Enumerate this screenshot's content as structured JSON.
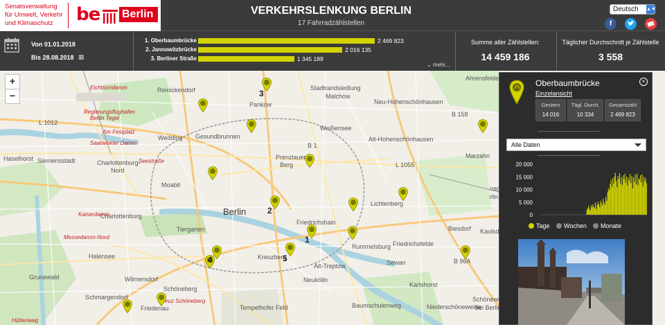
{
  "header": {
    "logo_text": [
      "Senatsverwaltung",
      "für Umwelt, Verkehr",
      "und Klimaschutz"
    ],
    "logo_be": "be",
    "logo_berlin": "Berlin",
    "title": "VERKEHRSLENKUNG BERLIN",
    "subtitle": "17 Fahrradzählstellen",
    "language": "Deutsch",
    "social": [
      "facebook-icon",
      "twitter-icon",
      "mail-icon"
    ]
  },
  "stats": {
    "date_from": "Von 01.01.2018",
    "date_to": "Bis 28.08.2018",
    "ranking": [
      {
        "label": "1. Oberbaumbrücke",
        "value_text": "2 469 823",
        "value": 2469823
      },
      {
        "label": "2. Jannowitzbrücke",
        "value_text": "2 016 135",
        "value": 2016135
      },
      {
        "label": "3. Berliner Straße",
        "value_text": "1 345 189",
        "value": 1345189
      }
    ],
    "more": "mehr...",
    "sum_label": "Summe aller Zählstellen:",
    "sum_value": "14 459 186",
    "avg_label": "Täglicher Durchschnitt je Zählstelle",
    "avg_value": "3 558"
  },
  "map": {
    "zoom_in": "+",
    "zoom_out": "−",
    "labels": [
      {
        "text": "Reinickendorf",
        "cls": ""
      },
      {
        "text": "Pankow",
        "cls": ""
      },
      {
        "text": "Stadtrandsiedlung",
        "cls": ""
      },
      {
        "text": "Malchow",
        "cls": ""
      },
      {
        "text": "Ahrensfelde",
        "cls": ""
      },
      {
        "text": "Neu-Hohenschönhausen",
        "cls": ""
      },
      {
        "text": "Weißensee",
        "cls": ""
      },
      {
        "text": "Alt-Hohenschönhausen",
        "cls": ""
      },
      {
        "text": "Gesundbrunnen",
        "cls": ""
      },
      {
        "text": "Prenzlauer",
        "cls": ""
      },
      {
        "text": "Berg",
        "cls": ""
      },
      {
        "text": "Wedding",
        "cls": ""
      },
      {
        "text": "Haselhorst",
        "cls": ""
      },
      {
        "text": "Siemensstadt",
        "cls": ""
      },
      {
        "text": "Charlottenburg-",
        "cls": ""
      },
      {
        "text": "Nord",
        "cls": ""
      },
      {
        "text": "Moabit",
        "cls": ""
      },
      {
        "text": "Berlin",
        "cls": "big"
      },
      {
        "text": "Lichtenberg",
        "cls": ""
      },
      {
        "text": "Charlottenburg",
        "cls": ""
      },
      {
        "text": "Tiergarten",
        "cls": ""
      },
      {
        "text": "Friedrichshain",
        "cls": ""
      },
      {
        "text": "Biesdorf",
        "cls": ""
      },
      {
        "text": "Kaulsdo",
        "cls": ""
      },
      {
        "text": "Rummelsburg",
        "cls": ""
      },
      {
        "text": "Friedrichsfelde",
        "cls": ""
      },
      {
        "text": "Halensee",
        "cls": ""
      },
      {
        "text": "Kreuzberg",
        "cls": ""
      },
      {
        "text": "Alt-Treptow",
        "cls": ""
      },
      {
        "text": "Grunewald",
        "cls": ""
      },
      {
        "text": "Wilmersdorf",
        "cls": ""
      },
      {
        "text": "Schöneberg",
        "cls": ""
      },
      {
        "text": "Neukölln",
        "cls": ""
      },
      {
        "text": "Karlshorst",
        "cls": ""
      },
      {
        "text": "Schmargendorf",
        "cls": ""
      },
      {
        "text": "Niederschöneweide",
        "cls": ""
      },
      {
        "text": "Friedenau",
        "cls": ""
      },
      {
        "text": "Baumschulenweg",
        "cls": ""
      },
      {
        "text": "Eichborndamm",
        "cls": "red"
      },
      {
        "text": "Regierungsflughafen",
        "cls": "red"
      },
      {
        "text": "Berlin Tegel",
        "cls": "red"
      },
      {
        "text": "Am Festplatz",
        "cls": "red"
      },
      {
        "text": "Saatwinkler Damm",
        "cls": "red"
      },
      {
        "text": "Seestraße",
        "cls": "red"
      },
      {
        "text": "Kaiserdamm",
        "cls": "red"
      },
      {
        "text": "Messedamm-Nord",
        "cls": "red"
      },
      {
        "text": "Kreuz Schöneberg",
        "cls": "red"
      },
      {
        "text": "Tempelhofer Feld",
        "cls": ""
      },
      {
        "text": "Hüttenweg",
        "cls": "red"
      },
      {
        "text": "Sewan",
        "cls": ""
      },
      {
        "text": "Schönewe",
        "cls": ""
      },
      {
        "text": "bei Berlin",
        "cls": ""
      },
      {
        "text": "nagen",
        "cls": ""
      },
      {
        "text": "rlin",
        "cls": ""
      },
      {
        "text": "Marzahn",
        "cls": ""
      },
      {
        "text": "L 1012",
        "cls": ""
      },
      {
        "text": "L 1055",
        "cls": ""
      },
      {
        "text": "B 158",
        "cls": ""
      },
      {
        "text": "B 1",
        "cls": ""
      },
      {
        "text": "B 96A",
        "cls": ""
      }
    ],
    "marker_ranks": [
      "3",
      "2",
      "1",
      "5",
      "4"
    ]
  },
  "panel": {
    "title": "Oberbaumbrücke",
    "subtitle": "Einzelansicht",
    "stats": [
      {
        "label": "Gestern",
        "value": "14 016"
      },
      {
        "label": "Tägl. Durch.",
        "value": "10 334"
      },
      {
        "label": "Gesamtzahl",
        "value": "2 469 823"
      }
    ],
    "select": "Alle Daten",
    "legend": [
      {
        "label": "Tage",
        "color": "#d2d300"
      },
      {
        "label": "Wochen",
        "color": "#888888"
      },
      {
        "label": "Monate",
        "color": "#888888"
      }
    ]
  },
  "chart_data": {
    "type": "bar",
    "yticks": [
      "20 000",
      "15 000",
      "10 000",
      "5 000",
      "0"
    ],
    "ylim": [
      0,
      20000
    ],
    "series": [
      {
        "values": [
          0,
          0,
          0,
          0,
          0,
          0,
          0,
          0,
          0,
          0,
          0,
          0,
          0,
          0,
          0,
          0,
          0,
          0,
          0,
          0,
          0,
          0,
          0,
          0,
          0,
          0,
          0,
          0,
          0,
          0,
          0,
          0,
          0,
          0,
          0,
          0,
          0,
          0,
          0,
          0,
          0,
          0,
          0,
          0,
          0,
          0,
          0,
          0,
          0,
          0,
          0,
          0,
          0,
          0,
          1800,
          2600,
          3500,
          2400,
          1700,
          3800,
          2900,
          4200,
          3300,
          2700,
          4800,
          2300,
          3900,
          5200,
          4100,
          3000,
          5600,
          4600,
          3700,
          6300,
          4900,
          4000,
          7100,
          5500,
          8900,
          10500,
          9800,
          12200,
          13800,
          11000,
          14500,
          12400,
          15200,
          16600,
          13500,
          10900,
          15400,
          14200,
          16400,
          12300,
          14900,
          11800,
          15600,
          14100,
          16200,
          12800,
          15100,
          11500,
          14700,
          13600,
          16100,
          12600,
          15300,
          10400,
          14800,
          13200,
          15900,
          12100,
          16300,
          11700,
          14400,
          13900,
          15700,
          12900,
          16000,
          11300,
          15000,
          13300,
          14600,
          12500
        ]
      }
    ]
  },
  "colors": {
    "header_bg": "#3b3b3b",
    "accent": "#d2d300",
    "brand_red": "#e0001b",
    "panel_bg": "#2c2c2c"
  }
}
